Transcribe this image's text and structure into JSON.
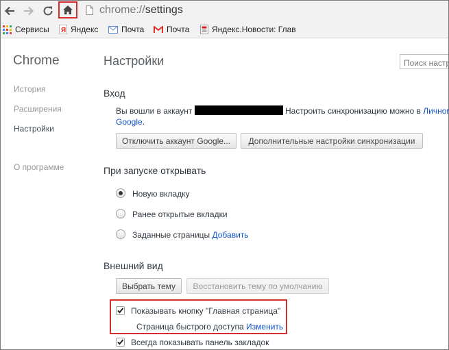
{
  "toolbar": {
    "url_scheme": "chrome://",
    "url_path": "settings",
    "back_icon": "arrow-left-icon",
    "forward_icon": "arrow-right-icon",
    "reload_icon": "reload-icon",
    "home_icon": "home-icon",
    "highlight_color": "#d32f2f"
  },
  "bookmarks": [
    {
      "label": "Сервисы",
      "icon": "apps-grid-icon"
    },
    {
      "label": "Яндекс",
      "icon": "yandex-icon"
    },
    {
      "label": "Почта",
      "icon": "mail-icon"
    },
    {
      "label": "Почта",
      "icon": "gmail-icon"
    },
    {
      "label": "Яндекс.Новости: Глав",
      "icon": "news-icon"
    }
  ],
  "sidebar": {
    "brand": "Chrome",
    "items": [
      {
        "label": "История"
      },
      {
        "label": "Расширения"
      },
      {
        "label": "Настройки"
      },
      {
        "label": "О программе"
      }
    ]
  },
  "main": {
    "title": "Настройки",
    "search_placeholder": "Поиск настр",
    "signin": {
      "heading": "Вход",
      "text_before": "Вы вошли в аккаунт",
      "text_after": "Настроить синхронизацию можно в",
      "link_part1": "Личном",
      "link_part2": "Google",
      "link_suffix": ".",
      "disconnect_button": "Отключить аккаунт Google...",
      "sync_button": "Дополнительные настройки синхронизации"
    },
    "startup": {
      "heading": "При запуске открывать",
      "options": [
        {
          "label": "Новую вкладку",
          "checked": true
        },
        {
          "label": "Ранее открытые вкладки",
          "checked": false
        },
        {
          "label": "Заданные страницы",
          "checked": false
        }
      ],
      "add_link": "Добавить"
    },
    "appearance": {
      "heading": "Внешний вид",
      "theme_button": "Выбрать тему",
      "reset_theme_button": "Восстановить тему по умолчанию",
      "show_home_label": "Показывать кнопку \"Главная страница\"",
      "show_home_checked": true,
      "home_page_label": "Страница быстрого доступа",
      "change_link": "Изменить",
      "show_bookmarks_label": "Всегда показывать панель закладок",
      "show_bookmarks_checked": true
    }
  }
}
